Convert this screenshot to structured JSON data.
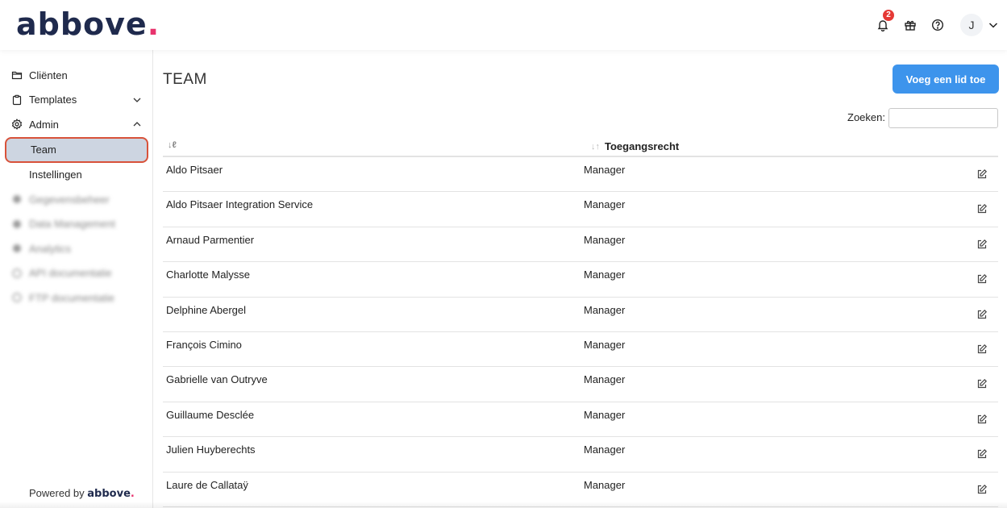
{
  "brand": {
    "logo_text": "abbove",
    "logo_dot": ".",
    "accent": "#e8336d",
    "navy": "#1f2a4d"
  },
  "header": {
    "notification_count": "2",
    "avatar_initial": "J"
  },
  "sidebar": {
    "items": [
      {
        "label": "Cliënten",
        "icon": "folder-icon"
      },
      {
        "label": "Templates",
        "icon": "clipboard-icon",
        "expandable": true,
        "expanded": false
      },
      {
        "label": "Admin",
        "icon": "gear-icon",
        "expandable": true,
        "expanded": true
      },
      {
        "label": "Team",
        "active": true
      },
      {
        "label": "Instellingen"
      },
      {
        "label": "Gegevensbeheer",
        "blurred": true
      },
      {
        "label": "Data Management",
        "blurred": true
      },
      {
        "label": "Analytics",
        "blurred": true
      },
      {
        "label": "API documentatie",
        "blurred": true
      },
      {
        "label": "FTP documentatie",
        "blurred": true
      }
    ],
    "powered_by": "Powered by",
    "powered_brand": "abbove",
    "powered_dot": "."
  },
  "main": {
    "title": "TEAM",
    "add_button": "Voeg een lid toe",
    "search_label": "Zoeken:",
    "search_value": "",
    "columns": {
      "name": "",
      "access": "Toegangsrecht"
    },
    "rows": [
      {
        "name": "Aldo Pitsaer",
        "role": "Manager"
      },
      {
        "name": "Aldo Pitsaer Integration Service",
        "role": "Manager"
      },
      {
        "name": "Arnaud Parmentier",
        "role": "Manager"
      },
      {
        "name": "Charlotte Malysse",
        "role": "Manager"
      },
      {
        "name": "Delphine Abergel",
        "role": "Manager"
      },
      {
        "name": "François Cimino",
        "role": "Manager"
      },
      {
        "name": "Gabrielle van Outryve",
        "role": "Manager"
      },
      {
        "name": "Guillaume Desclée",
        "role": "Manager"
      },
      {
        "name": "Julien Huyberechts",
        "role": "Manager"
      },
      {
        "name": "Laure de Callataÿ",
        "role": "Manager"
      }
    ]
  },
  "colors": {
    "primary_button": "#3d94ec",
    "active_item_bg": "#cdd5e1",
    "highlight_border": "#d8523a",
    "badge": "#e53935"
  }
}
